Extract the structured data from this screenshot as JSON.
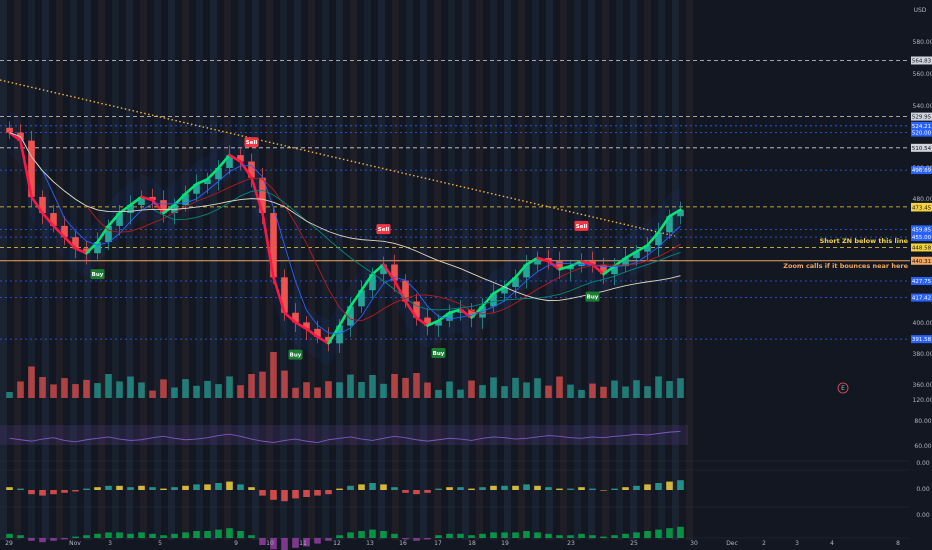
{
  "currency_label": "USD",
  "colors": {
    "background": "#131722",
    "up": "#26a69a",
    "down": "#ef5350",
    "bright_green": "#00e676",
    "bright_red": "#ff1744",
    "blue_level": "#2962ff",
    "yellow": "#f5d33f",
    "orange_level": "#f0a560",
    "white_level": "#d1d4dc",
    "sell_badge": "#f23645",
    "buy_badge": "#1b7d33"
  },
  "annotations": {
    "short_zone": "Short ZN below this line",
    "zoom_call": "Zoom calls if it bounces near here",
    "circled_mark": "E"
  },
  "chart_data": [
    {
      "type": "candlestick",
      "panel": "price",
      "price_axis_ticks": [
        "580.00",
        "560.00",
        "540.00",
        "500.00",
        "480.00",
        "400.00",
        "380.00",
        "360.00"
      ],
      "date_ticks": [
        "29",
        "Nov",
        "3",
        "5",
        "9",
        "10",
        "11",
        "12",
        "13",
        "16",
        "17",
        "18",
        "19",
        "23",
        "25",
        "30",
        "Dec",
        "2",
        "3",
        "4",
        "8"
      ],
      "ylim": [
        355,
        590
      ],
      "horizontal_levels": [
        {
          "label": "564.83",
          "value": 564.83,
          "style": "dashed",
          "color": "white"
        },
        {
          "label": "529.95",
          "value": 529.95,
          "style": "dashed",
          "color": "white"
        },
        {
          "label": "524.21",
          "value": 524.21,
          "style": "dashed",
          "color": "blue"
        },
        {
          "label": "520.00",
          "value": 520.0,
          "style": "dashed",
          "color": "blue"
        },
        {
          "label": "510.54",
          "value": 510.54,
          "style": "dashed",
          "color": "white"
        },
        {
          "label": "496.69",
          "value": 496.69,
          "style": "dashed",
          "color": "blue"
        },
        {
          "label": "473.80",
          "value": 473.8,
          "style": "dashed",
          "color": "yellow"
        },
        {
          "label": "473.45",
          "value": 473.45,
          "style": "label",
          "color": "yellow"
        },
        {
          "label": "459.85",
          "value": 459.85,
          "style": "dashed",
          "color": "blue"
        },
        {
          "label": "455.00",
          "value": 455.0,
          "style": "dashed",
          "color": "blue"
        },
        {
          "label": "448.58",
          "value": 448.58,
          "style": "dashed",
          "color": "yellow"
        },
        {
          "label": "440.31",
          "value": 440.31,
          "style": "solid",
          "color": "orange"
        },
        {
          "label": "427.75",
          "value": 427.75,
          "style": "dashed",
          "color": "blue"
        },
        {
          "label": "417.42",
          "value": 417.42,
          "style": "dashed",
          "color": "blue"
        },
        {
          "label": "391.58",
          "value": 391.58,
          "style": "dashed",
          "color": "blue"
        }
      ],
      "series": [
        {
          "name": "close",
          "values": [
            520,
            515,
            480,
            470,
            462,
            455,
            448,
            445,
            452,
            462,
            470,
            475,
            480,
            478,
            470,
            475,
            482,
            488,
            491,
            498,
            506,
            502,
            492,
            470,
            430,
            408,
            402,
            398,
            393,
            389,
            400,
            412,
            422,
            432,
            438,
            428,
            415,
            405,
            400,
            403,
            408,
            410,
            405,
            412,
            420,
            424,
            430,
            438,
            442,
            440,
            435,
            437,
            440,
            438,
            432,
            437,
            442,
            446,
            450,
            458,
            468,
            472
          ]
        }
      ],
      "signals": [
        {
          "label": "Sell",
          "index": 22
        },
        {
          "label": "Buy",
          "index": 8
        },
        {
          "label": "Buy",
          "index": 26
        },
        {
          "label": "Sell",
          "index": 34
        },
        {
          "label": "Buy",
          "index": 39
        },
        {
          "label": "Sell",
          "index": 52
        },
        {
          "label": "Buy",
          "index": 53
        }
      ]
    },
    {
      "type": "line",
      "panel": "oscillator",
      "axis_ticks": [
        "120.00",
        "80.00",
        "60.00"
      ],
      "ylim": [
        50,
        125
      ],
      "series": [
        {
          "values": [
            74,
            72,
            70,
            73,
            75,
            71,
            69,
            72,
            74,
            76,
            73,
            71,
            72,
            75,
            77,
            74,
            72,
            73,
            75,
            78,
            80,
            77,
            73,
            70,
            68,
            71,
            73,
            70,
            68,
            72,
            74,
            76,
            73,
            71,
            74,
            77,
            75,
            72,
            70,
            72,
            74,
            73,
            71,
            74,
            76,
            75,
            73,
            74,
            76,
            78,
            77,
            75,
            74,
            76,
            75,
            77,
            78,
            80,
            79,
            81,
            83,
            84
          ]
        }
      ]
    },
    {
      "type": "histogram",
      "panel": "macd",
      "axis_ticks": [
        "0.00",
        "0.00"
      ],
      "ylim": [
        -1,
        1
      ],
      "series": [
        {
          "values": [
            0.2,
            0.1,
            -0.3,
            -0.4,
            -0.3,
            -0.2,
            -0.1,
            0.1,
            0.2,
            0.3,
            0.3,
            0.2,
            0.3,
            0.2,
            0.1,
            0.2,
            0.3,
            0.4,
            0.4,
            0.5,
            0.6,
            0.4,
            0.2,
            -0.4,
            -0.7,
            -0.8,
            -0.6,
            -0.5,
            -0.4,
            -0.3,
            0.1,
            0.3,
            0.4,
            0.5,
            0.4,
            0.2,
            -0.2,
            -0.3,
            -0.2,
            0.1,
            0.2,
            0.2,
            0.1,
            0.2,
            0.3,
            0.3,
            0.3,
            0.4,
            0.3,
            0.2,
            0.1,
            0.1,
            0.2,
            0.1,
            0.0,
            0.1,
            0.2,
            0.3,
            0.4,
            0.5,
            0.6,
            0.7
          ]
        }
      ]
    },
    {
      "type": "histogram",
      "panel": "momentum",
      "axis_ticks": [
        "0.00"
      ],
      "ylim": [
        -1,
        1
      ],
      "series": [
        {
          "values": [
            0.3,
            0.2,
            -0.2,
            -0.3,
            -0.2,
            -0.1,
            0.1,
            0.2,
            0.3,
            0.4,
            0.4,
            0.3,
            0.4,
            0.3,
            0.2,
            0.3,
            0.4,
            0.5,
            0.5,
            0.6,
            0.7,
            0.5,
            0.2,
            -0.5,
            -0.8,
            -0.9,
            -0.7,
            -0.6,
            -0.4,
            -0.2,
            0.2,
            0.4,
            0.5,
            0.6,
            0.5,
            0.3,
            -0.1,
            -0.2,
            -0.1,
            0.2,
            0.3,
            0.3,
            0.2,
            0.3,
            0.4,
            0.4,
            0.4,
            0.5,
            0.4,
            0.3,
            0.2,
            0.2,
            0.3,
            0.2,
            0.1,
            0.2,
            0.3,
            0.4,
            0.5,
            0.6,
            0.7,
            0.8
          ]
        }
      ]
    }
  ]
}
